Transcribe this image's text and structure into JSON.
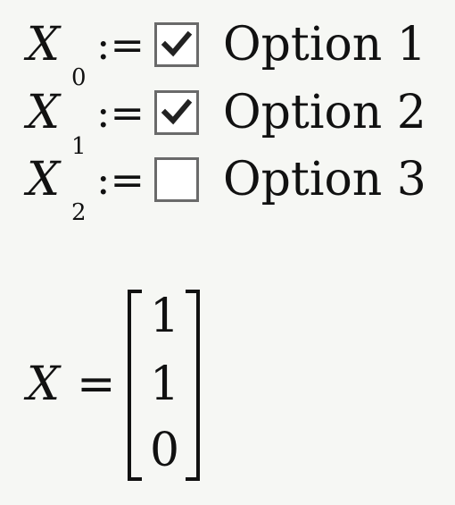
{
  "assignments": [
    {
      "variable": "X",
      "subscript": "",
      "operator": ":=",
      "checked": true,
      "label": "Option 1"
    },
    {
      "variable": "X",
      "subscript": "0",
      "operator": ":=",
      "checked": true,
      "label": "Option 2"
    },
    {
      "variable": "X",
      "subscript": "1",
      "subscript_below": "2",
      "operator": ":=",
      "checked": false,
      "label": "Option 3"
    }
  ],
  "result": {
    "variable": "X",
    "operator": "=",
    "values": [
      "1",
      "1",
      "0"
    ]
  },
  "icons": {
    "checkmark": "check-icon"
  }
}
